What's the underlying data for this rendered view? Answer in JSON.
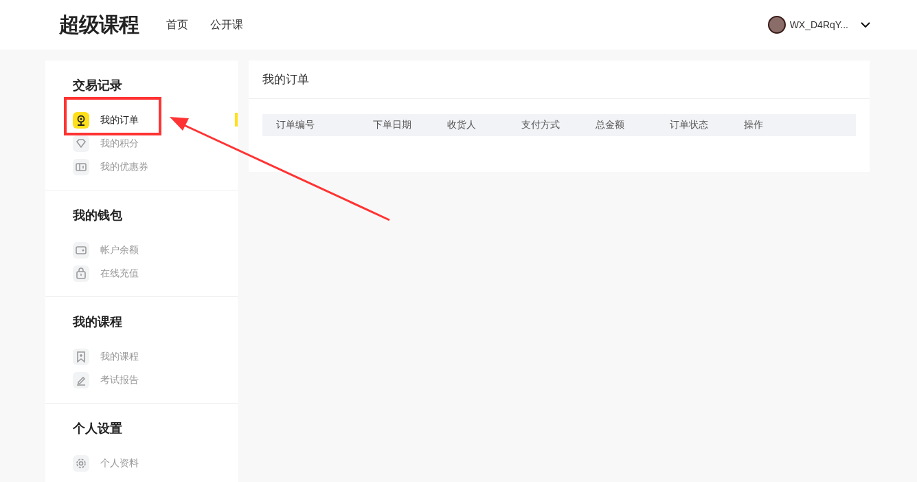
{
  "header": {
    "logo": "超级课程",
    "nav": [
      {
        "label": "首页",
        "selected": false
      },
      {
        "label": "公开课",
        "selected": false
      }
    ],
    "user": {
      "name": "WX_D4RqY..."
    }
  },
  "sidebar": {
    "sections": [
      {
        "title": "交易记录",
        "items": [
          {
            "label": "我的订单",
            "selected": true
          },
          {
            "label": "我的积分",
            "selected": false
          },
          {
            "label": "我的优惠券",
            "selected": false
          }
        ]
      },
      {
        "title": "我的钱包",
        "items": [
          {
            "label": "帐户余额",
            "selected": false
          },
          {
            "label": "在线充值",
            "selected": false
          }
        ]
      },
      {
        "title": "我的课程",
        "items": [
          {
            "label": "我的课程",
            "selected": false
          },
          {
            "label": "考试报告",
            "selected": false
          }
        ]
      },
      {
        "title": "个人设置",
        "items": [
          {
            "label": "个人资料",
            "selected": false
          }
        ]
      }
    ]
  },
  "main": {
    "title": "我的订单",
    "table": {
      "columns": [
        "订单编号",
        "下单日期",
        "收货人",
        "支付方式",
        "总金额",
        "订单状态",
        "操作"
      ]
    }
  }
}
